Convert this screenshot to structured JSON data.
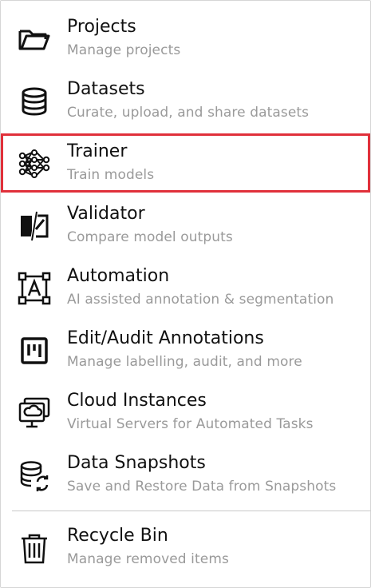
{
  "menu": {
    "items": [
      {
        "title": "Projects",
        "subtitle": "Manage projects",
        "icon": "folder-icon"
      },
      {
        "title": "Datasets",
        "subtitle": "Curate, upload, and share datasets",
        "icon": "database-icon"
      },
      {
        "title": "Trainer",
        "subtitle": "Train models",
        "icon": "neural-network-icon"
      },
      {
        "title": "Validator",
        "subtitle": "Compare model outputs",
        "icon": "compare-icon"
      },
      {
        "title": "Automation",
        "subtitle": "AI assisted annotation & segmentation",
        "icon": "annotation-box-icon"
      },
      {
        "title": "Edit/Audit Annotations",
        "subtitle": "Manage labelling, audit, and more",
        "icon": "kanban-icon"
      },
      {
        "title": "Cloud Instances",
        "subtitle": "Virtual Servers for Automated Tasks",
        "icon": "cloud-monitor-icon"
      },
      {
        "title": "Data Snapshots",
        "subtitle": "Save and Restore Data from Snapshots",
        "icon": "database-sync-icon"
      }
    ],
    "footer_item": {
      "title": "Recycle Bin",
      "subtitle": "Manage removed items",
      "icon": "trash-icon"
    },
    "selected": "Trainer",
    "highlight_color": "#e0303a"
  }
}
